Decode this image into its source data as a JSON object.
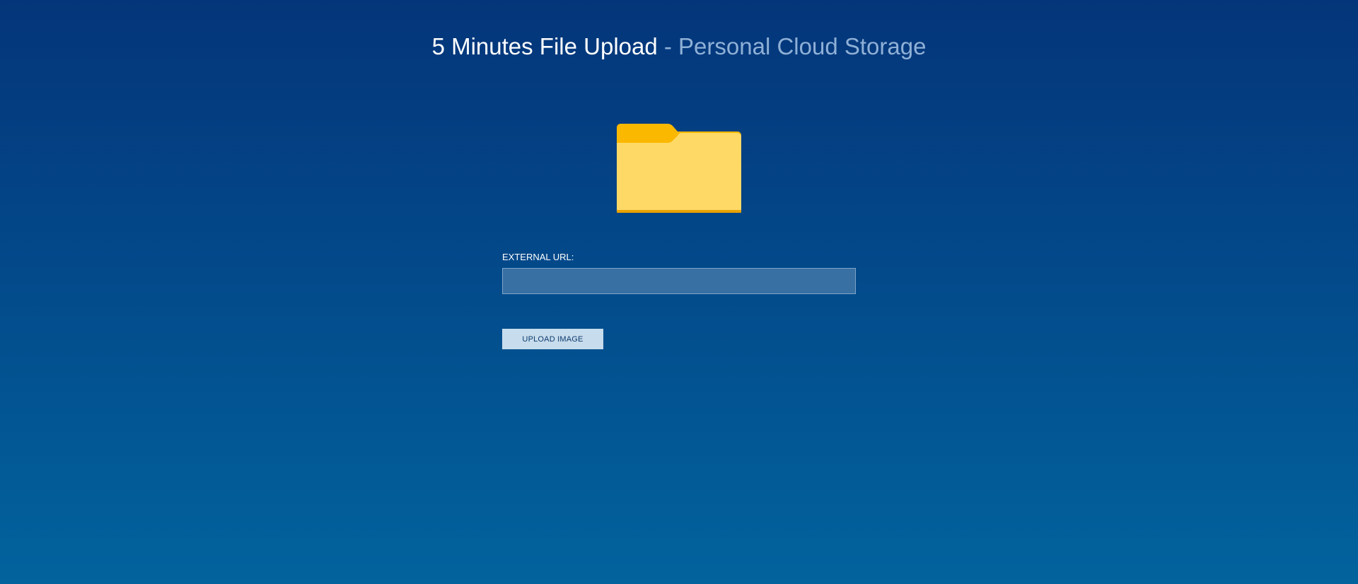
{
  "header": {
    "title": "5 Minutes File Upload",
    "subtitle": "- Personal Cloud Storage"
  },
  "icon": {
    "name": "folder-icon",
    "colors": {
      "tab": "#fbb800",
      "body": "#fed966",
      "edge": "#e9a200"
    }
  },
  "form": {
    "url_label": "EXTERNAL URL:",
    "url_value": "",
    "url_placeholder": "",
    "upload_label": "UPLOAD IMAGE"
  },
  "colors": {
    "background_top": "#04357a",
    "background_bottom": "#02639d",
    "input_background": "#3870a4",
    "button_background": "#c7dcec",
    "button_text": "#0d3a6e",
    "subtitle_text": "#8fb0d6"
  }
}
